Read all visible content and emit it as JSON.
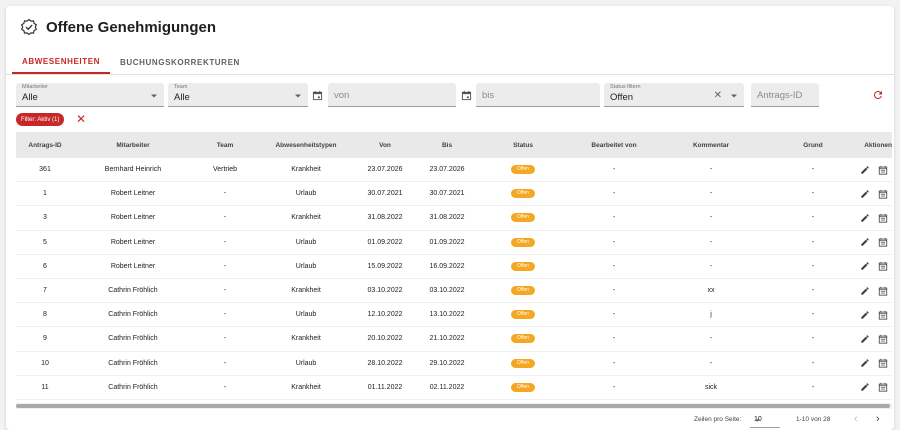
{
  "header": {
    "title": "Offene Genehmigungen",
    "icon": "approval-check-icon"
  },
  "tabs": [
    {
      "label": "ABWESENHEITEN",
      "active": true
    },
    {
      "label": "BUCHUNGSKORREKTUREN",
      "active": false
    }
  ],
  "filters": {
    "mitarbeiter": {
      "label": "Mitarbeiter",
      "value": "Alle"
    },
    "team": {
      "label": "Team",
      "value": "Alle"
    },
    "von": {
      "placeholder": "von"
    },
    "bis": {
      "placeholder": "bis"
    },
    "status": {
      "label": "Status filtern",
      "value": "Offen"
    },
    "antrags_id": {
      "placeholder": "Antrags-ID"
    }
  },
  "filter_chip": {
    "label": "Filter: Aktiv (1)"
  },
  "table": {
    "columns": [
      "Antrags-ID",
      "Mitarbeiter",
      "Team",
      "Abwesenheitstypen",
      "Von",
      "Bis",
      "Status",
      "Bearbeitet von",
      "Kommentar",
      "Grund",
      "Aktionen"
    ],
    "rows": [
      {
        "id": "361",
        "mitarbeiter": "Bernhard Heinrich",
        "team": "Vertrieb",
        "typ": "Krankheit",
        "von": "23.07.2026",
        "bis": "23.07.2026",
        "status": "Offen",
        "bearbeitet": "-",
        "kommentar": "-",
        "grund": "-"
      },
      {
        "id": "1",
        "mitarbeiter": "Robert Leitner",
        "team": "-",
        "typ": "Urlaub",
        "von": "30.07.2021",
        "bis": "30.07.2021",
        "status": "Offen",
        "bearbeitet": "-",
        "kommentar": "-",
        "grund": "-"
      },
      {
        "id": "3",
        "mitarbeiter": "Robert Leitner",
        "team": "-",
        "typ": "Krankheit",
        "von": "31.08.2022",
        "bis": "31.08.2022",
        "status": "Offen",
        "bearbeitet": "-",
        "kommentar": "-",
        "grund": "-"
      },
      {
        "id": "5",
        "mitarbeiter": "Robert Leitner",
        "team": "-",
        "typ": "Urlaub",
        "von": "01.09.2022",
        "bis": "01.09.2022",
        "status": "Offen",
        "bearbeitet": "-",
        "kommentar": "-",
        "grund": "-"
      },
      {
        "id": "6",
        "mitarbeiter": "Robert Leitner",
        "team": "-",
        "typ": "Urlaub",
        "von": "15.09.2022",
        "bis": "16.09.2022",
        "status": "Offen",
        "bearbeitet": "-",
        "kommentar": "-",
        "grund": "-"
      },
      {
        "id": "7",
        "mitarbeiter": "Cathrin Fröhlich",
        "team": "-",
        "typ": "Krankheit",
        "von": "03.10.2022",
        "bis": "03.10.2022",
        "status": "Offen",
        "bearbeitet": "-",
        "kommentar": "xx",
        "grund": "-"
      },
      {
        "id": "8",
        "mitarbeiter": "Cathrin Fröhlich",
        "team": "-",
        "typ": "Urlaub",
        "von": "12.10.2022",
        "bis": "13.10.2022",
        "status": "Offen",
        "bearbeitet": "-",
        "kommentar": "j",
        "grund": "-"
      },
      {
        "id": "9",
        "mitarbeiter": "Cathrin Fröhlich",
        "team": "-",
        "typ": "Krankheit",
        "von": "20.10.2022",
        "bis": "21.10.2022",
        "status": "Offen",
        "bearbeitet": "-",
        "kommentar": "-",
        "grund": "-"
      },
      {
        "id": "10",
        "mitarbeiter": "Cathrin Fröhlich",
        "team": "-",
        "typ": "Urlaub",
        "von": "28.10.2022",
        "bis": "29.10.2022",
        "status": "Offen",
        "bearbeitet": "-",
        "kommentar": "-",
        "grund": "-"
      },
      {
        "id": "11",
        "mitarbeiter": "Cathrin Fröhlich",
        "team": "-",
        "typ": "Krankheit",
        "von": "01.11.2022",
        "bis": "02.11.2022",
        "status": "Offen",
        "bearbeitet": "-",
        "kommentar": "sick",
        "grund": "-"
      }
    ]
  },
  "paginator": {
    "rows_label": "Zeilen pro Seite:",
    "rows_value": "10",
    "range": "1-10 von 28"
  },
  "colors": {
    "accent": "#c62828",
    "badge": "#f5a623"
  }
}
